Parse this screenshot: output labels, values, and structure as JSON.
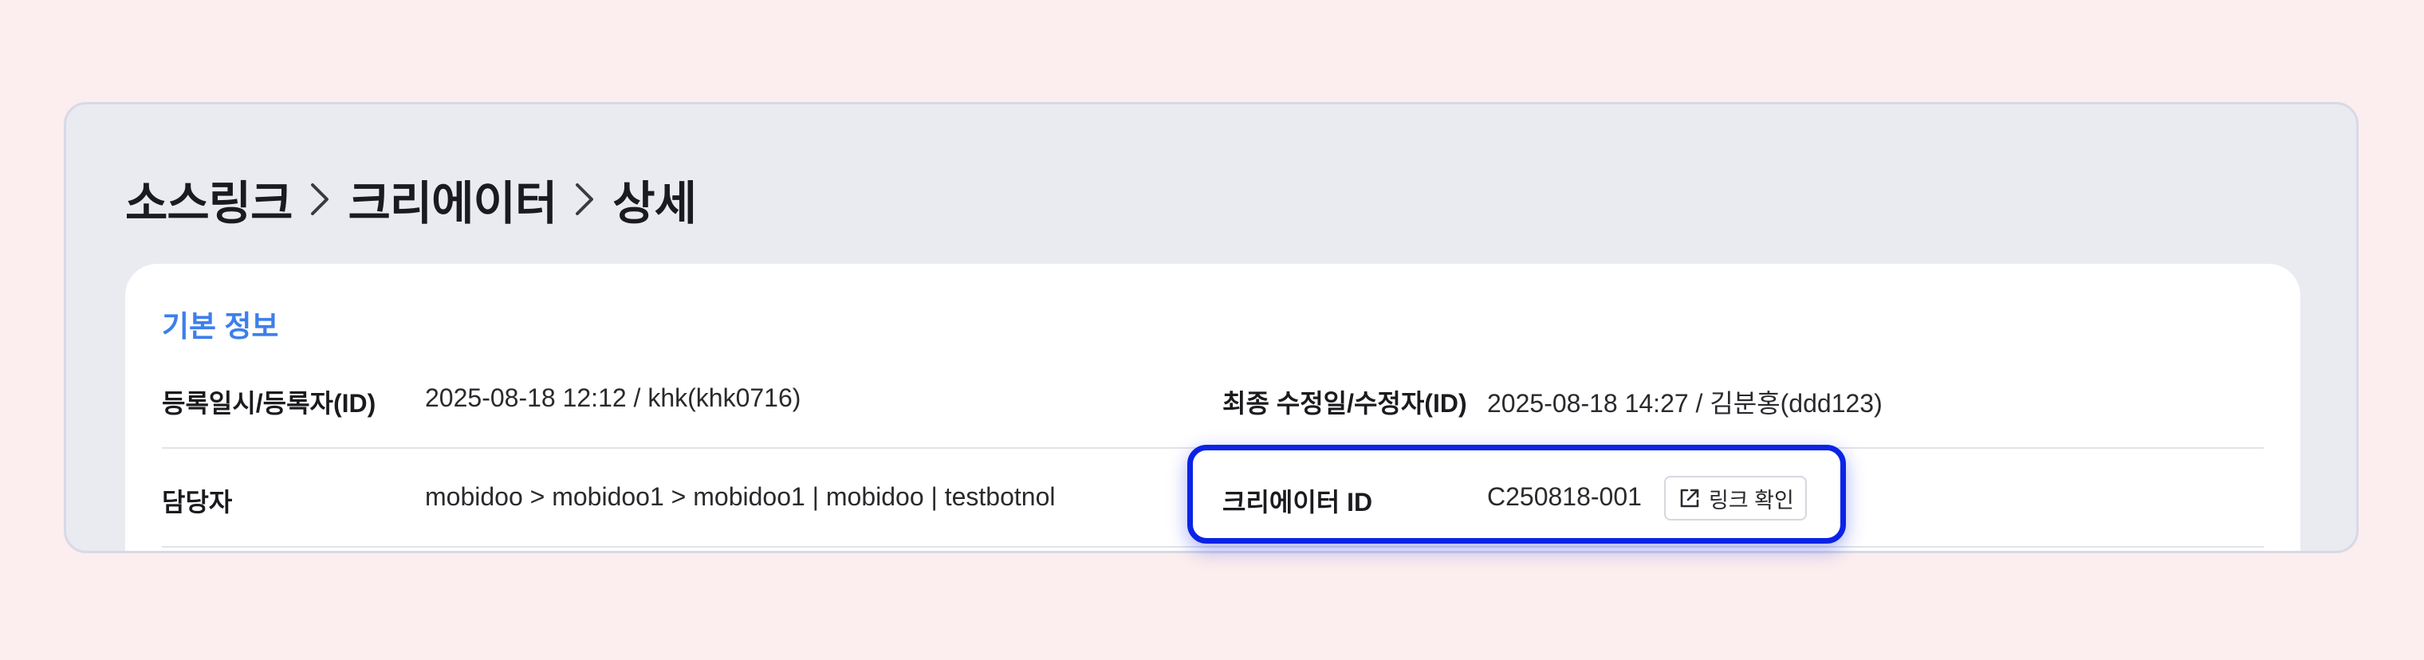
{
  "breadcrumb": {
    "items": [
      "소스링크",
      "크리에이터",
      "상세"
    ]
  },
  "section": {
    "title": "기본 정보"
  },
  "info": {
    "registered_label": "등록일시/등록자(ID)",
    "registered_value": "2025-08-18 12:12 / khk(khk0716)",
    "modified_label": "최종 수정일/수정자(ID)",
    "modified_value": "2025-08-18 14:27 / 김분홍(ddd123)",
    "manager_label": "담당자",
    "manager_value": "mobidoo > mobidoo1 > mobidoo1 | mobidoo | testbotnol",
    "creator_id_label": "크리에이터 ID",
    "creator_id_value": "C250818-001",
    "link_button_label": "링크 확인"
  },
  "colors": {
    "background": "#fcedee",
    "section_title": "#3d7fea",
    "highlight": "#0b23e6"
  }
}
